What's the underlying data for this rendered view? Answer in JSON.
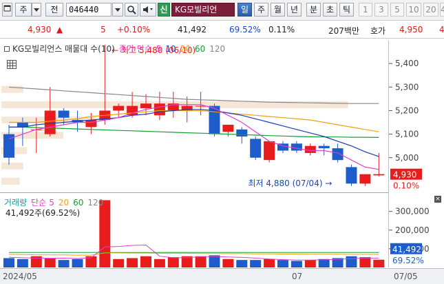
{
  "toolbar": {
    "market": "주",
    "jeon": "전",
    "code": "046440",
    "sin": "신",
    "stock_name": "KG모빌리언",
    "periods": [
      "일",
      "주",
      "월",
      "년",
      "분",
      "초",
      "틱"
    ],
    "active_period": "일",
    "intervals": [
      "1",
      "3",
      "5",
      "10",
      "20"
    ],
    "extra": "4"
  },
  "quote": {
    "price": "4,930",
    "arrow": "▲",
    "change": "5",
    "change_pct": "+0.10%",
    "volume": "41,492",
    "vol_ratio": "69.52%",
    "turnover": "0.11%",
    "amount": "207백만",
    "hoga_label": "호가",
    "hoga_value": "4,950",
    "extra": "4"
  },
  "price_panel": {
    "title": "KG모빌리언스 매물대 수(10)",
    "ma_label": "종가 단순",
    "ma_periods": [
      "5",
      "10",
      "20",
      "60",
      "120"
    ],
    "high_label": "최고 5,480 (06/10)",
    "low_label": "최저 4,880 (07/04)",
    "axis_ticks": [
      "5,400",
      "5,300",
      "5,200",
      "5,100",
      "5,000"
    ],
    "current_price": "4,930",
    "current_pct": "0.10%"
  },
  "volume_panel": {
    "title": "거래량",
    "ma_label": "단순",
    "ma_periods": [
      "5",
      "20",
      "60",
      "120"
    ],
    "summary": "41,492주(69.52%)",
    "axis_ticks": [
      "300,000",
      "200,000",
      "100,000"
    ],
    "current_volume": "41,492",
    "current_pct": "69.52%"
  },
  "date_axis": {
    "left": "2024/05",
    "mid": "07",
    "right": "07/05"
  },
  "colors": {
    "up": "#e81c1c",
    "down": "#1e5ccc",
    "ma5": "#e040c8",
    "ma10": "#1a3cb8",
    "ma20": "#f0a010",
    "ma60": "#10a030",
    "ma120": "#888888",
    "profile": "#f5e6d6"
  },
  "chart_data": {
    "type": "candlestick",
    "y_range": [
      4850,
      5500
    ],
    "candles": [
      {
        "o": 5100,
        "h": 5140,
        "l": 4970,
        "c": 5000
      },
      {
        "o": 5150,
        "h": 5170,
        "l": 5050,
        "c": 5130
      },
      {
        "o": 5120,
        "h": 5170,
        "l": 5020,
        "c": 5120
      },
      {
        "o": 5100,
        "h": 5300,
        "l": 5090,
        "c": 5200
      },
      {
        "o": 5200,
        "h": 5210,
        "l": 5140,
        "c": 5170
      },
      {
        "o": 5160,
        "h": 5200,
        "l": 5110,
        "c": 5150
      },
      {
        "o": 5130,
        "h": 5190,
        "l": 5100,
        "c": 5160
      },
      {
        "o": 5160,
        "h": 5480,
        "l": 5140,
        "c": 5200
      },
      {
        "o": 5200,
        "h": 5230,
        "l": 5170,
        "c": 5220
      },
      {
        "o": 5180,
        "h": 5280,
        "l": 5170,
        "c": 5220
      },
      {
        "o": 5210,
        "h": 5270,
        "l": 5180,
        "c": 5230
      },
      {
        "o": 5180,
        "h": 5280,
        "l": 5160,
        "c": 5230
      },
      {
        "o": 5200,
        "h": 5280,
        "l": 5170,
        "c": 5230
      },
      {
        "o": 5200,
        "h": 5260,
        "l": 5150,
        "c": 5220
      },
      {
        "o": 5220,
        "h": 5280,
        "l": 5180,
        "c": 5220
      },
      {
        "o": 5220,
        "h": 5230,
        "l": 5090,
        "c": 5100
      },
      {
        "o": 5110,
        "h": 5140,
        "l": 5090,
        "c": 5140
      },
      {
        "o": 5120,
        "h": 5130,
        "l": 5060,
        "c": 5090
      },
      {
        "o": 5080,
        "h": 5090,
        "l": 4990,
        "c": 5000
      },
      {
        "o": 4990,
        "h": 5070,
        "l": 4980,
        "c": 5070
      },
      {
        "o": 5060,
        "h": 5070,
        "l": 5020,
        "c": 5030
      },
      {
        "o": 5060,
        "h": 5070,
        "l": 5020,
        "c": 5030
      },
      {
        "o": 5020,
        "h": 5060,
        "l": 5010,
        "c": 5050
      },
      {
        "o": 5050,
        "h": 5060,
        "l": 5010,
        "c": 5040
      },
      {
        "o": 5040,
        "h": 5060,
        "l": 4980,
        "c": 4990
      },
      {
        "o": 4960,
        "h": 4970,
        "l": 4880,
        "c": 4890
      },
      {
        "o": 4890,
        "h": 4930,
        "l": 4880,
        "c": 4930
      },
      {
        "o": 4925,
        "h": 5020,
        "l": 4920,
        "c": 4930
      }
    ],
    "ma5": [
      5080,
      5100,
      5120,
      5130,
      5140,
      5150,
      5150,
      5160,
      5170,
      5190,
      5205,
      5215,
      5225,
      5225,
      5225,
      5210,
      5180,
      5150,
      5110,
      5070,
      5050,
      5040,
      5030,
      5030,
      5020,
      4990,
      4960,
      4950
    ],
    "ma10": [
      5130,
      5130,
      5140,
      5145,
      5150,
      5155,
      5160,
      5165,
      5170,
      5180,
      5185,
      5195,
      5200,
      5205,
      5205,
      5200,
      5190,
      5180,
      5165,
      5150,
      5135,
      5120,
      5105,
      5090,
      5070,
      5050,
      5025,
      5005
    ],
    "ma20": [
      5150,
      5150,
      5150,
      5155,
      5160,
      5165,
      5175,
      5180,
      5185,
      5190,
      5195,
      5200,
      5200,
      5200,
      5200,
      5195,
      5190,
      5185,
      5180,
      5175,
      5170,
      5165,
      5160,
      5150,
      5140,
      5130,
      5120,
      5110
    ],
    "ma60": [
      5130,
      5130,
      5128,
      5126,
      5124,
      5122,
      5120,
      5118,
      5116,
      5114,
      5112,
      5110,
      5108,
      5106,
      5104,
      5102,
      5100,
      5098,
      5096,
      5094,
      5092,
      5090,
      5089,
      5088,
      5088,
      5087,
      5087,
      5086
    ],
    "ma120": [
      5300,
      5296,
      5292,
      5288,
      5284,
      5280,
      5276,
      5272,
      5268,
      5264,
      5260,
      5256,
      5252,
      5248,
      5246,
      5244,
      5242,
      5240,
      5238,
      5236,
      5235,
      5234,
      5233,
      5232,
      5231,
      5230,
      5230,
      5230
    ],
    "profile": [
      {
        "price": 4900,
        "width": 0.05
      },
      {
        "price": 4965,
        "width": 0.06
      },
      {
        "price": 5030,
        "width": 0.07
      },
      {
        "price": 5095,
        "width": 0.17
      },
      {
        "price": 5160,
        "width": 0.26
      },
      {
        "price": 5225,
        "width": 0.95
      },
      {
        "price": 5290,
        "width": 0.06
      }
    ],
    "volume_range": [
      0,
      380000
    ],
    "volumes": [
      50000,
      45000,
      60000,
      50000,
      40000,
      45000,
      60000,
      360000,
      45000,
      50000,
      60000,
      45000,
      55000,
      60000,
      60000,
      65000,
      45000,
      40000,
      40000,
      45000,
      40000,
      35000,
      40000,
      45000,
      50000,
      60000,
      55000,
      41492
    ],
    "vol_ma5": [
      55000,
      52000,
      50000,
      49000,
      50000,
      48000,
      52000,
      110000,
      112000,
      118000,
      120000,
      60000,
      52000,
      52000,
      58000,
      58000,
      56000,
      54000,
      50000,
      45000,
      42000,
      40000,
      40000,
      41000,
      44000,
      47000,
      50000,
      50000
    ],
    "vol_ma20": [
      70000,
      69000,
      68000,
      67000,
      67000,
      66000,
      66000,
      78000,
      78000,
      77000,
      77000,
      76000,
      76000,
      76000,
      75000,
      75000,
      74000,
      74000,
      73000,
      73000,
      72000,
      72000,
      71000,
      71000,
      71000,
      70000,
      70000,
      70000
    ],
    "vol_ma60": [
      80000,
      80000,
      80000,
      80000,
      80000,
      80000,
      80000,
      80000,
      80000,
      80000,
      80000,
      80000,
      80000,
      80000,
      80000,
      80000,
      80000,
      80000,
      80000,
      80000,
      80000,
      80000,
      80000,
      80000,
      80000,
      80000,
      80000,
      80000
    ]
  }
}
